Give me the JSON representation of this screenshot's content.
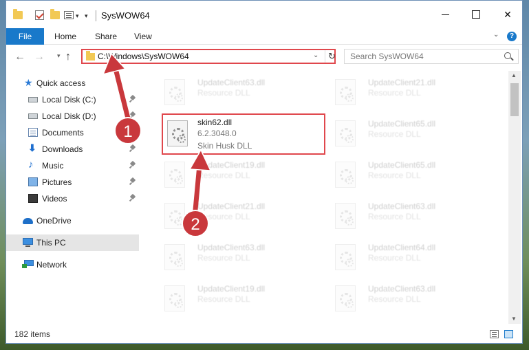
{
  "titlebar": {
    "title": "SysWOW64",
    "minimize_glyph": "",
    "maximize_glyph": "",
    "close_glyph": "✕"
  },
  "ribbon": {
    "tabs": [
      "File",
      "Home",
      "Share",
      "View"
    ],
    "help": "?"
  },
  "navbar": {
    "back": "←",
    "forward": "→",
    "up": "↑",
    "address": "C:\\Windows\\SysWOW64",
    "search_placeholder": "Search SysWOW64",
    "refresh": "↻"
  },
  "sidebar": {
    "items": [
      {
        "label": "Quick access",
        "pinned": false
      },
      {
        "label": "Local Disk (C:)",
        "pinned": true
      },
      {
        "label": "Local Disk (D:)",
        "pinned": true
      },
      {
        "label": "Documents",
        "pinned": true
      },
      {
        "label": "Downloads",
        "pinned": true
      },
      {
        "label": "Music",
        "pinned": true
      },
      {
        "label": "Pictures",
        "pinned": true
      },
      {
        "label": "Videos",
        "pinned": true
      },
      {
        "label": "OneDrive",
        "pinned": false
      },
      {
        "label": "This PC",
        "pinned": false
      },
      {
        "label": "Network",
        "pinned": false
      }
    ]
  },
  "files": {
    "highlighted": {
      "name": "skin62.dll",
      "version": "6.2.3048.0",
      "description": "Skin Husk DLL"
    },
    "left_column": [
      {
        "name": "UpdateClient63.dll",
        "description": "Resource DLL"
      },
      {
        "name": "UpdateClient19.dll",
        "description": "Resource DLL"
      },
      {
        "name": "UpdateClient21.dll",
        "description": "Resource DLL"
      },
      {
        "name": "UpdateClient63.dll",
        "description": "Resource DLL"
      },
      {
        "name": "UpdateClient19.dll",
        "description": "Resource DLL"
      }
    ],
    "right_column": [
      {
        "name": "UpdateClient21.dll",
        "description": "Resource DLL"
      },
      {
        "name": "UpdateClient65.dll",
        "description": "Resource DLL"
      },
      {
        "name": "UpdateClient65.dll",
        "description": "Resource DLL"
      },
      {
        "name": "UpdateClient63.dll",
        "description": "Resource DLL"
      },
      {
        "name": "UpdateClient64.dll",
        "description": "Resource DLL"
      },
      {
        "name": "UpdateClient63.dll",
        "description": "Resource DLL"
      }
    ]
  },
  "statusbar": {
    "item_count": "182 items"
  },
  "annotations": {
    "step1": "1",
    "step2": "2",
    "color": "#c9383c"
  }
}
